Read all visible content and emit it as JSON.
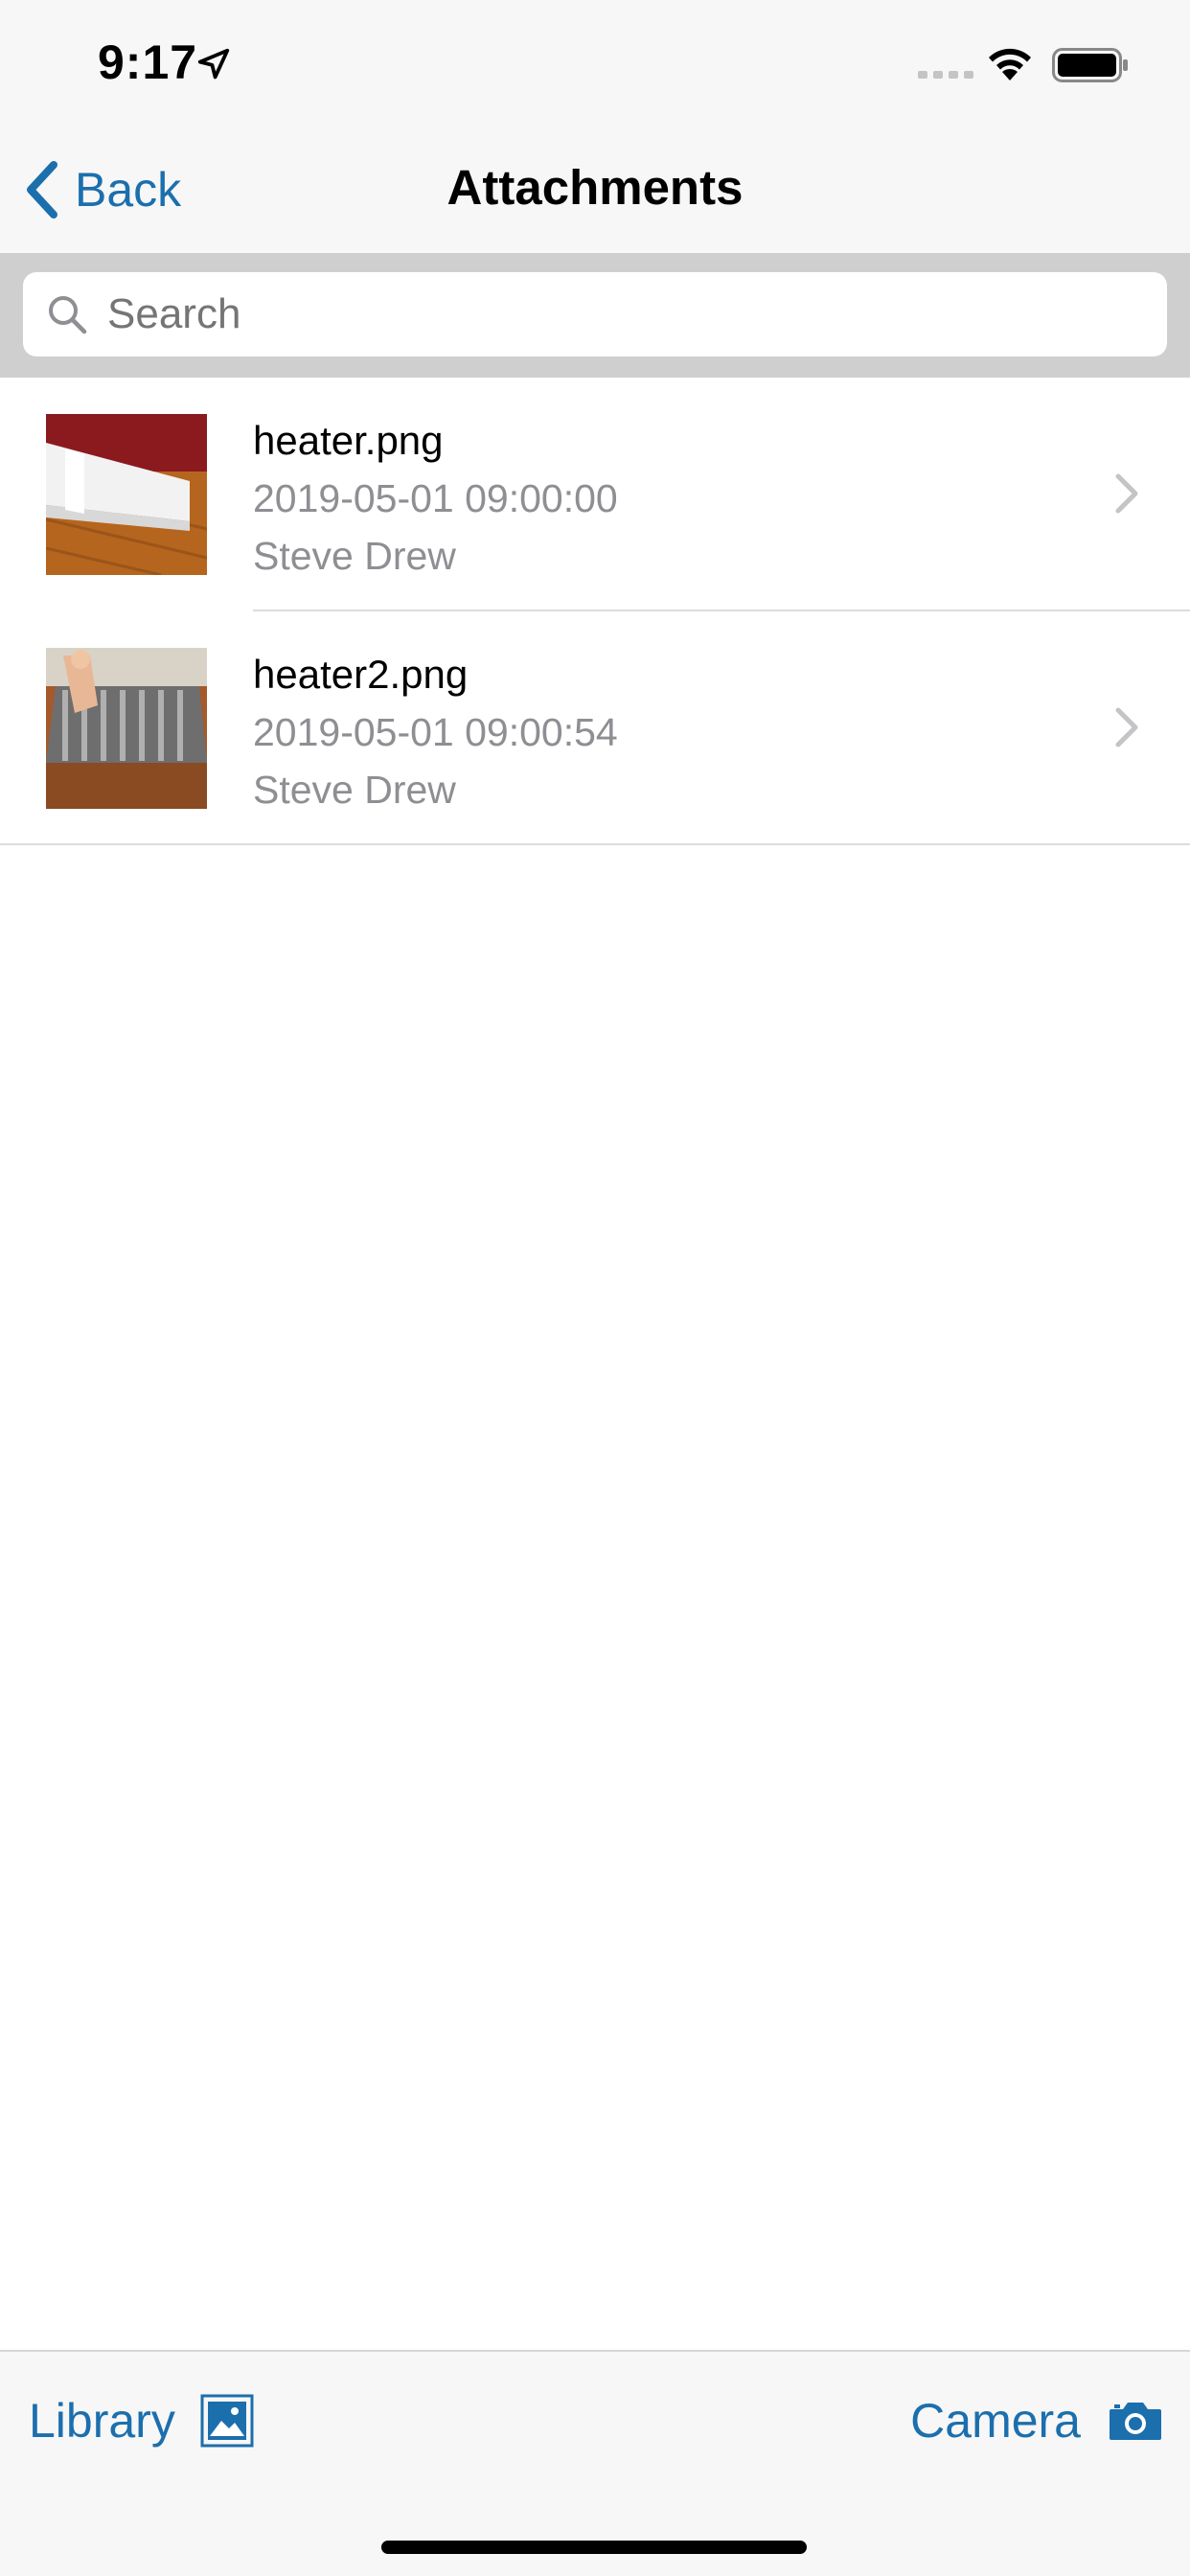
{
  "status_bar": {
    "time": "9:17",
    "icons": [
      "location-arrow-icon",
      "cellular-signal-icon",
      "wifi-icon",
      "battery-icon"
    ]
  },
  "nav": {
    "back_label": "Back",
    "title": "Attachments"
  },
  "search": {
    "placeholder": "Search"
  },
  "attachments": [
    {
      "name": "heater.png",
      "date": "2019-05-01 09:00:00",
      "author": "Steve Drew"
    },
    {
      "name": "heater2.png",
      "date": "2019-05-01 09:00:54",
      "author": "Steve Drew"
    }
  ],
  "toolbar": {
    "library_label": "Library",
    "camera_label": "Camera"
  },
  "colors": {
    "accent": "#1c6fad",
    "secondary_text": "#8e8e93",
    "bar_background": "#f7f7f7",
    "search_bar_background": "#cfcfcf"
  }
}
